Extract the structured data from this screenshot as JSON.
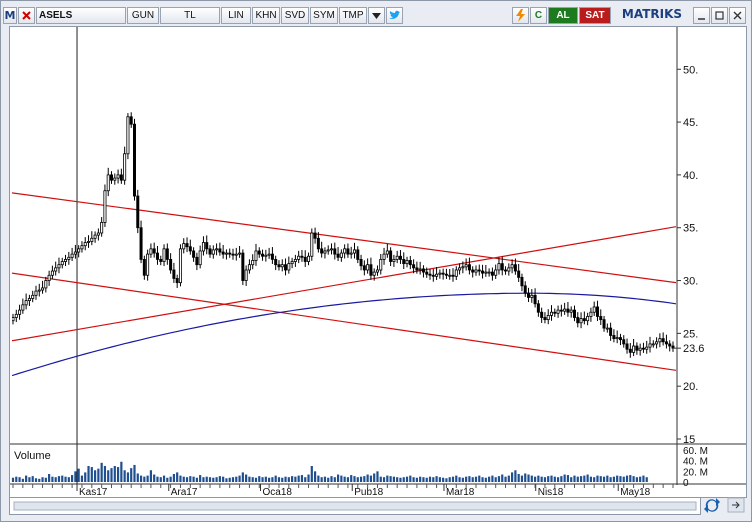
{
  "toolbar": {
    "m_label": "M",
    "symbol": "ASELS",
    "period": "GUN",
    "currency": "TL",
    "scale": "LIN",
    "btn_khn": "KHN",
    "btn_svd": "SVD",
    "btn_sym": "SYM",
    "btn_tmp": "TMP",
    "dropdown_icon": "triangle-down",
    "twitter_icon": "twitter-bird",
    "flash_icon": "lightning",
    "refresh_icon": "circular-arrow",
    "refresh_label": "C",
    "buy_label": "AL",
    "sell_label": "SAT",
    "brand": "MATRIKS",
    "window_controls": [
      "minimize",
      "restore",
      "close"
    ]
  },
  "colors": {
    "candle": "#000000",
    "channel_lines": "#d01010",
    "moving_average": "#1a1aa0",
    "volume_bars": "#1f4f8f",
    "buy_bg": "#1e7a1e",
    "sell_bg": "#b81c1c",
    "brand": "#1c3f80"
  },
  "chart_data": {
    "type": "candlestick",
    "symbol": "ASELS",
    "y_ticks": [
      "50.",
      "45.",
      "40.",
      "35.",
      "30.",
      "25.",
      "23.6",
      "20.",
      "15"
    ],
    "ylim": [
      15,
      54
    ],
    "last_price": 23.6,
    "x_ticks": [
      "Kas17",
      "Ara17",
      "Oca18",
      "Pub18",
      "Mar18",
      "Nis18",
      "May18"
    ],
    "close": [
      26.5,
      26.8,
      27.2,
      27.7,
      28.1,
      28.3,
      28.6,
      29.0,
      29.1,
      29.3,
      30.0,
      30.5,
      30.9,
      31.2,
      31.5,
      31.8,
      32.0,
      32.2,
      32.5,
      32.7,
      33.0,
      33.3,
      33.6,
      33.7,
      34.0,
      34.3,
      34.5,
      35.5,
      38.5,
      40.0,
      39.5,
      39.7,
      40.0,
      39.5,
      42.0,
      45.5,
      44.8,
      38.0,
      35.0,
      32.0,
      30.5,
      32.5,
      33.0,
      32.6,
      32.0,
      31.8,
      33.0,
      32.0,
      31.0,
      30.2,
      29.8,
      33.0,
      33.5,
      33.2,
      32.8,
      32.2,
      31.5,
      32.8,
      33.6,
      33.0,
      32.5,
      32.9,
      33.0,
      32.7,
      32.5,
      32.6,
      32.5,
      32.4,
      32.5,
      32.6,
      30.0,
      31.0,
      31.5,
      31.9,
      32.8,
      32.5,
      32.3,
      32.4,
      32.5,
      32.0,
      31.5,
      31.3,
      31.5,
      31.0,
      31.6,
      31.8,
      32.0,
      32.3,
      32.2,
      31.8,
      32.3,
      34.5,
      34.0,
      33.0,
      32.6,
      32.8,
      32.9,
      33.0,
      32.5,
      32.2,
      32.6,
      33.0,
      32.5,
      32.6,
      32.9,
      32.0,
      31.4,
      31.0,
      31.5,
      30.5,
      30.8,
      31.0,
      32.0,
      32.5,
      32.8,
      31.8,
      32.0,
      32.3,
      32.0,
      31.6,
      31.9,
      31.5,
      31.2,
      31.0,
      31.1,
      30.8,
      30.6,
      30.5,
      30.4,
      30.6,
      30.7,
      30.6,
      30.5,
      30.5,
      30.4,
      31.0,
      31.2,
      31.3,
      31.5,
      31.0,
      30.8,
      31.0,
      30.9,
      30.7,
      30.8,
      30.8,
      30.5,
      31.0,
      31.6,
      31.0,
      30.9,
      31.2,
      31.5,
      30.9,
      30.3,
      29.5,
      28.8,
      28.4,
      28.6,
      27.8,
      27.0,
      26.5,
      26.3,
      26.7,
      27.0,
      26.9,
      27.2,
      27.1,
      27.3,
      27.0,
      27.2,
      26.5,
      26.0,
      26.4,
      26.2,
      26.6,
      27.0,
      27.5,
      26.6,
      26.3,
      25.5,
      25.5,
      24.8,
      24.5,
      24.6,
      24.4,
      24.0,
      23.5,
      23.2,
      23.8,
      23.4,
      23.6,
      23.5,
      23.7,
      24.0,
      24.0,
      24.2,
      24.5,
      24.2,
      24.0,
      23.8,
      23.6
    ],
    "moving_average_endpoints": [
      "start 21.0",
      "peak 28.8",
      "end 27.8"
    ],
    "channel_lines": [
      {
        "from_date": "Kas17",
        "from_value": 30.7,
        "to_value": 21.5
      },
      {
        "from_date": "Kas17",
        "from_value": 24.3,
        "to_value": 35.1
      },
      {
        "from_date": "Kas17",
        "from_value": 38.3,
        "to_value": 29.8
      }
    ],
    "volume_axis_ticks": [
      "60. M",
      "40. M",
      "20. M",
      "0"
    ],
    "volume_max_m": 60,
    "volume_m": [
      8,
      10,
      9,
      6,
      12,
      9,
      11,
      7,
      6,
      9,
      8,
      15,
      10,
      9,
      11,
      12,
      10,
      9,
      13,
      20,
      25,
      12,
      18,
      30,
      28,
      22,
      25,
      36,
      30,
      22,
      26,
      30,
      28,
      38,
      22,
      18,
      26,
      32,
      16,
      12,
      10,
      12,
      22,
      14,
      10,
      9,
      12,
      8,
      10,
      15,
      18,
      12,
      10,
      9,
      11,
      10,
      8,
      13,
      9,
      10,
      9,
      8,
      9,
      11,
      10,
      7,
      8,
      9,
      10,
      12,
      18,
      14,
      10,
      9,
      8,
      11,
      9,
      10,
      8,
      9,
      12,
      9,
      8,
      10,
      9,
      11,
      10,
      12,
      13,
      9,
      14,
      30,
      20,
      12,
      9,
      10,
      8,
      11,
      9,
      14,
      12,
      10,
      9,
      13,
      11,
      9,
      10,
      11,
      14,
      12,
      16,
      20,
      10,
      9,
      12,
      11,
      10,
      9,
      8,
      9,
      10,
      12,
      9,
      8,
      10,
      9,
      8,
      10,
      9,
      11,
      9,
      8,
      7,
      9,
      10,
      12,
      9,
      8,
      10,
      11,
      9,
      10,
      12,
      9,
      8,
      10,
      12,
      9,
      11,
      14,
      10,
      12,
      18,
      22,
      15,
      12,
      16,
      14,
      12,
      10,
      12,
      10,
      9,
      11,
      12,
      10,
      9,
      11,
      14,
      13,
      9,
      12,
      10,
      11,
      12,
      14,
      10,
      9,
      12,
      11,
      10,
      12,
      9,
      10,
      12,
      11,
      10,
      12,
      13,
      11,
      9,
      10,
      12,
      9
    ],
    "volume_label": "Volume"
  }
}
